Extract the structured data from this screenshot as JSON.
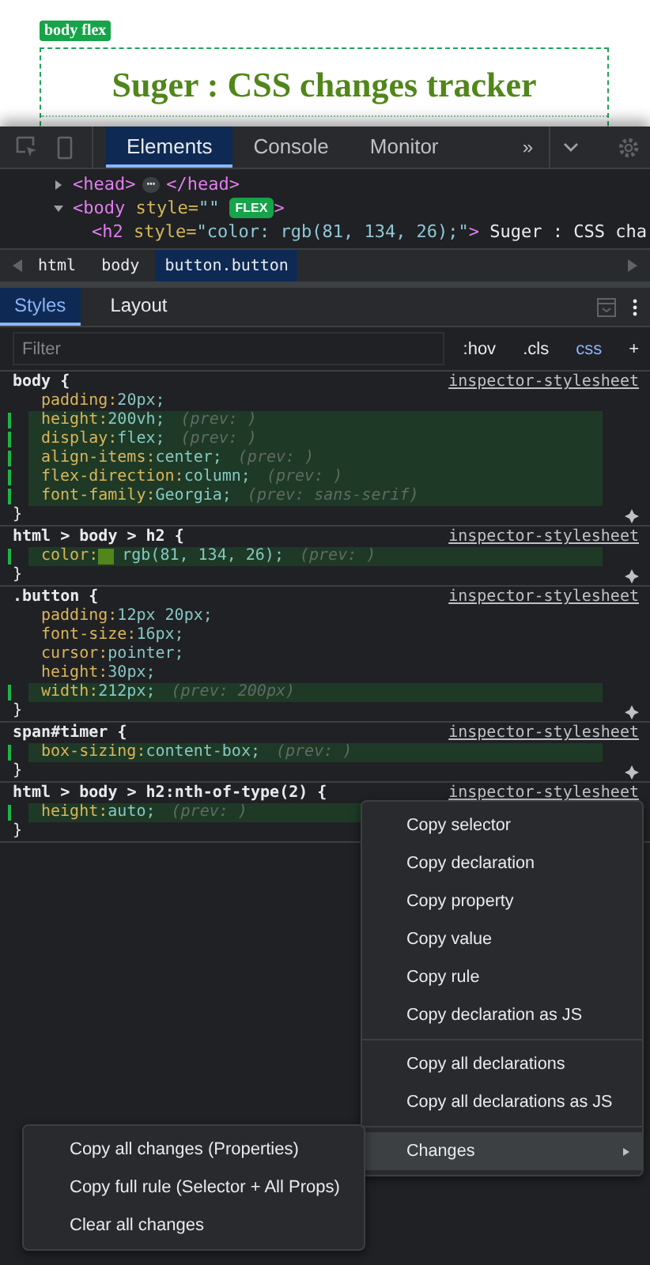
{
  "page_preview": {
    "badge": "body flex",
    "title": "Suger : CSS changes tracker"
  },
  "toolbar": {
    "tabs": [
      {
        "label": "Elements",
        "selected": true
      },
      {
        "label": "Console",
        "selected": false
      },
      {
        "label": "Monitor",
        "selected": false
      }
    ],
    "overflow": "»"
  },
  "dom_tree": [
    {
      "expanded": false,
      "tag": "<head>",
      "ellipsis": "⋯",
      "close_tag": "</head>"
    },
    {
      "expanded": true,
      "tag": "<body",
      "attr_name": " style=",
      "attr_value": "\"\"",
      "badge": "FLEX",
      "close_tag": ">"
    },
    {
      "tag": "<h2",
      "attr_name": " style=",
      "attr_value": "\"color: rgb(81, 134, 26);\"",
      "close_tag": ">",
      "text": " Suger : CSS cha"
    }
  ],
  "breadcrumbs": [
    {
      "label": "html",
      "selected": false
    },
    {
      "label": "body",
      "selected": false
    },
    {
      "label": "button.button",
      "selected": true
    }
  ],
  "styles_tabs": [
    {
      "label": "Styles",
      "selected": true
    },
    {
      "label": "Layout",
      "selected": false
    }
  ],
  "filter": {
    "placeholder": "Filter"
  },
  "filter_buttons": [
    {
      "label": ":hov",
      "selected": false
    },
    {
      "label": ".cls",
      "selected": false
    },
    {
      "label": "css",
      "selected": true
    },
    {
      "label": "+",
      "selected": false
    }
  ],
  "rules": [
    {
      "selector": "body {",
      "source": "inspector-stylesheet",
      "declarations": [
        {
          "property": "padding:",
          "value": "20px;",
          "changed": false
        },
        {
          "property": "height:",
          "value": "200vh;",
          "changed": true,
          "prev": "(prev: )"
        },
        {
          "property": "display:",
          "value": "flex;",
          "changed": true,
          "prev": "(prev: )"
        },
        {
          "property": "align-items:",
          "value": "center;",
          "changed": true,
          "prev": "(prev: )"
        },
        {
          "property": "flex-direction:",
          "value": "column;",
          "changed": true,
          "prev": "(prev: )"
        },
        {
          "property": "font-family:",
          "value": "Georgia;",
          "changed": true,
          "prev": "(prev: sans-serif)"
        }
      ]
    },
    {
      "selector": "html > body > h2 {",
      "source": "inspector-stylesheet",
      "declarations": [
        {
          "property": "color:",
          "value": "rgb(81, 134, 26);",
          "changed": true,
          "prev": "(prev: )",
          "color": "#51861a"
        }
      ]
    },
    {
      "selector": ".button {",
      "source": "inspector-stylesheet",
      "declarations": [
        {
          "property": "padding:",
          "value": "12px 20px;",
          "changed": false
        },
        {
          "property": "font-size:",
          "value": "16px;",
          "changed": false
        },
        {
          "property": "cursor:",
          "value": "pointer;",
          "changed": false
        },
        {
          "property": "height:",
          "value": "30px;",
          "changed": false
        },
        {
          "property": "width:",
          "value": "212px;",
          "changed": true,
          "prev": "(prev: 200px)"
        }
      ]
    },
    {
      "selector": "span#timer {",
      "source": "inspector-stylesheet",
      "declarations": [
        {
          "property": "box-sizing:",
          "value": "content-box;",
          "changed": true,
          "prev": "(prev: )"
        }
      ]
    },
    {
      "selector": "html > body > h2:nth-of-type(2) {",
      "source": "inspector-stylesheet",
      "declarations": [
        {
          "property": "height:",
          "value": "auto;",
          "changed": true,
          "prev": "(prev: )"
        }
      ]
    }
  ],
  "rule_close": "}",
  "context_menu": {
    "groups": [
      [
        {
          "label": "Copy selector"
        },
        {
          "label": "Copy declaration"
        },
        {
          "label": "Copy property"
        },
        {
          "label": "Copy value"
        },
        {
          "label": "Copy rule"
        },
        {
          "label": "Copy declaration as JS"
        }
      ],
      [
        {
          "label": "Copy all declarations"
        },
        {
          "label": "Copy all declarations as JS"
        }
      ],
      [
        {
          "label": "Changes",
          "submenu": true,
          "selected": true
        }
      ]
    ]
  },
  "submenu": [
    {
      "label": "Copy all changes (Properties)"
    },
    {
      "label": "Copy full rule (Selector + All Props)"
    },
    {
      "label": "Clear all changes"
    }
  ]
}
